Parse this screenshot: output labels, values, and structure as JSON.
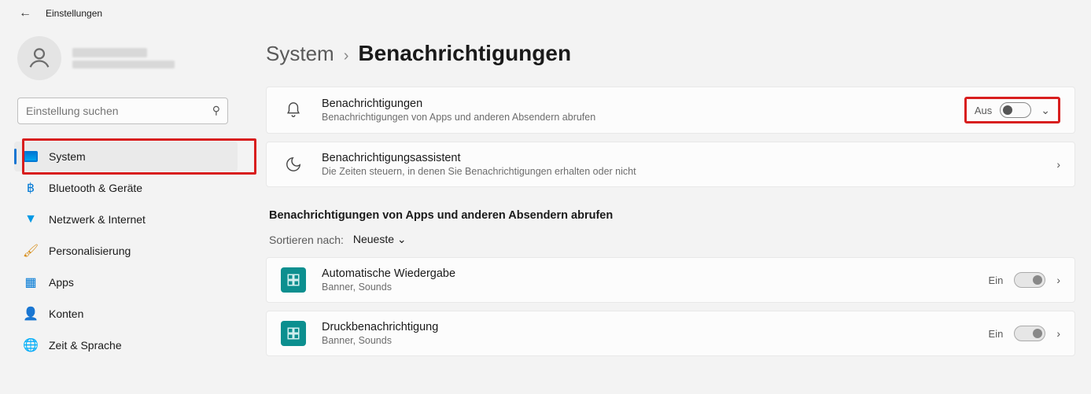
{
  "titlebar": {
    "title": "Einstellungen"
  },
  "search": {
    "placeholder": "Einstellung suchen"
  },
  "nav": [
    {
      "key": "system",
      "label": "System",
      "active": true
    },
    {
      "key": "bluetooth",
      "label": "Bluetooth & Geräte",
      "active": false
    },
    {
      "key": "network",
      "label": "Netzwerk & Internet",
      "active": false
    },
    {
      "key": "personal",
      "label": "Personalisierung",
      "active": false
    },
    {
      "key": "apps",
      "label": "Apps",
      "active": false
    },
    {
      "key": "accounts",
      "label": "Konten",
      "active": false
    },
    {
      "key": "time",
      "label": "Zeit & Sprache",
      "active": false
    }
  ],
  "breadcrumb": {
    "parent": "System",
    "current": "Benachrichtigungen"
  },
  "cards": {
    "notifications": {
      "title": "Benachrichtigungen",
      "subtitle": "Benachrichtigungen von Apps und anderen Absendern abrufen",
      "toggle_label": "Aus",
      "toggle_on": false
    },
    "assistant": {
      "title": "Benachrichtigungsassistent",
      "subtitle": "Die Zeiten steuern, in denen Sie Benachrichtigungen erhalten oder nicht"
    }
  },
  "section_title": "Benachrichtigungen von Apps und anderen Absendern abrufen",
  "sort": {
    "label": "Sortieren nach:",
    "value": "Neueste"
  },
  "apps": [
    {
      "title": "Automatische Wiedergabe",
      "subtitle": "Banner, Sounds",
      "toggle_label": "Ein",
      "toggle_on": true
    },
    {
      "title": "Druckbenachrichtigung",
      "subtitle": "Banner, Sounds",
      "toggle_label": "Ein",
      "toggle_on": true
    }
  ]
}
